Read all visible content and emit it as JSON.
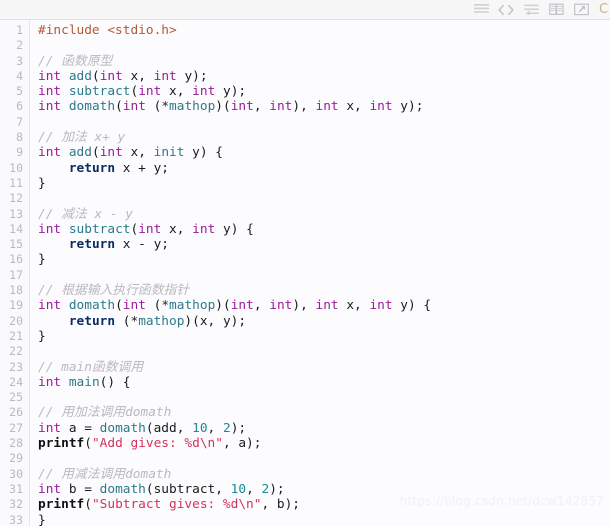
{
  "toolbar": {
    "icons": [
      {
        "name": "menu-lines-icon",
        "label": "Menu"
      },
      {
        "name": "code-brackets-icon",
        "label": "Code view"
      },
      {
        "name": "wrap-lines-icon",
        "label": "Toggle word wrap"
      },
      {
        "name": "copy-icon",
        "label": "Copy"
      },
      {
        "name": "open-external-icon",
        "label": "Open in new window"
      }
    ],
    "language_label": "C"
  },
  "editor": {
    "line_numbers": [
      "1",
      "2",
      "3",
      "4",
      "5",
      "6",
      "7",
      "8",
      "9",
      "10",
      "11",
      "12",
      "13",
      "14",
      "15",
      "16",
      "17",
      "18",
      "19",
      "20",
      "21",
      "22",
      "23",
      "24",
      "25",
      "26",
      "27",
      "28",
      "29",
      "30",
      "31",
      "32",
      "33"
    ],
    "lines": [
      [
        {
          "t": "pre",
          "s": "#include <stdio.h>"
        }
      ],
      [],
      [
        {
          "t": "cmt",
          "s": "// 函数原型"
        }
      ],
      [
        {
          "t": "kw",
          "s": "int"
        },
        {
          "t": "plain",
          "s": " "
        },
        {
          "t": "fn",
          "s": "add"
        },
        {
          "t": "plain",
          "s": "("
        },
        {
          "t": "kw",
          "s": "int"
        },
        {
          "t": "plain",
          "s": " x, "
        },
        {
          "t": "kw",
          "s": "int"
        },
        {
          "t": "plain",
          "s": " y);"
        }
      ],
      [
        {
          "t": "kw",
          "s": "int"
        },
        {
          "t": "plain",
          "s": " "
        },
        {
          "t": "fn",
          "s": "subtract"
        },
        {
          "t": "plain",
          "s": "("
        },
        {
          "t": "kw",
          "s": "int"
        },
        {
          "t": "plain",
          "s": " x, "
        },
        {
          "t": "kw",
          "s": "int"
        },
        {
          "t": "plain",
          "s": " y);"
        }
      ],
      [
        {
          "t": "kw",
          "s": "int"
        },
        {
          "t": "plain",
          "s": " "
        },
        {
          "t": "fn",
          "s": "domath"
        },
        {
          "t": "plain",
          "s": "("
        },
        {
          "t": "kw",
          "s": "int"
        },
        {
          "t": "plain",
          "s": " (*"
        },
        {
          "t": "fn",
          "s": "mathop"
        },
        {
          "t": "plain",
          "s": ")("
        },
        {
          "t": "kw",
          "s": "int"
        },
        {
          "t": "plain",
          "s": ", "
        },
        {
          "t": "kw",
          "s": "int"
        },
        {
          "t": "plain",
          "s": "), "
        },
        {
          "t": "kw",
          "s": "int"
        },
        {
          "t": "plain",
          "s": " x, "
        },
        {
          "t": "kw",
          "s": "int"
        },
        {
          "t": "plain",
          "s": " y);"
        }
      ],
      [],
      [
        {
          "t": "cmt",
          "s": "// 加法 x+ y"
        }
      ],
      [
        {
          "t": "kw",
          "s": "int"
        },
        {
          "t": "plain",
          "s": " "
        },
        {
          "t": "fn",
          "s": "add"
        },
        {
          "t": "plain",
          "s": "("
        },
        {
          "t": "kw",
          "s": "int"
        },
        {
          "t": "plain",
          "s": " x, "
        },
        {
          "t": "fn",
          "s": "init"
        },
        {
          "t": "plain",
          "s": " y) {"
        }
      ],
      [
        {
          "t": "plain",
          "s": "    "
        },
        {
          "t": "kw2",
          "s": "return"
        },
        {
          "t": "plain",
          "s": " x + y;"
        }
      ],
      [
        {
          "t": "plain",
          "s": "}"
        }
      ],
      [],
      [
        {
          "t": "cmt",
          "s": "// 减法 x - y"
        }
      ],
      [
        {
          "t": "kw",
          "s": "int"
        },
        {
          "t": "plain",
          "s": " "
        },
        {
          "t": "fn",
          "s": "subtract"
        },
        {
          "t": "plain",
          "s": "("
        },
        {
          "t": "kw",
          "s": "int"
        },
        {
          "t": "plain",
          "s": " x, "
        },
        {
          "t": "kw",
          "s": "int"
        },
        {
          "t": "plain",
          "s": " y) {"
        }
      ],
      [
        {
          "t": "plain",
          "s": "    "
        },
        {
          "t": "kw2",
          "s": "return"
        },
        {
          "t": "plain",
          "s": " x - y;"
        }
      ],
      [
        {
          "t": "plain",
          "s": "}"
        }
      ],
      [],
      [
        {
          "t": "cmt",
          "s": "// 根据输入执行函数指针"
        }
      ],
      [
        {
          "t": "kw",
          "s": "int"
        },
        {
          "t": "plain",
          "s": " "
        },
        {
          "t": "fn",
          "s": "domath"
        },
        {
          "t": "plain",
          "s": "("
        },
        {
          "t": "kw",
          "s": "int"
        },
        {
          "t": "plain",
          "s": " (*"
        },
        {
          "t": "fn",
          "s": "mathop"
        },
        {
          "t": "plain",
          "s": ")("
        },
        {
          "t": "kw",
          "s": "int"
        },
        {
          "t": "plain",
          "s": ", "
        },
        {
          "t": "kw",
          "s": "int"
        },
        {
          "t": "plain",
          "s": "), "
        },
        {
          "t": "kw",
          "s": "int"
        },
        {
          "t": "plain",
          "s": " x, "
        },
        {
          "t": "kw",
          "s": "int"
        },
        {
          "t": "plain",
          "s": " y) {"
        }
      ],
      [
        {
          "t": "plain",
          "s": "    "
        },
        {
          "t": "kw2",
          "s": "return"
        },
        {
          "t": "plain",
          "s": " (*"
        },
        {
          "t": "fn",
          "s": "mathop"
        },
        {
          "t": "plain",
          "s": ")(x, y);"
        }
      ],
      [
        {
          "t": "plain",
          "s": "}"
        }
      ],
      [],
      [
        {
          "t": "cmt",
          "s": "// main函数调用"
        }
      ],
      [
        {
          "t": "kw",
          "s": "int"
        },
        {
          "t": "plain",
          "s": " "
        },
        {
          "t": "fn",
          "s": "main"
        },
        {
          "t": "plain",
          "s": "() {"
        }
      ],
      [],
      [
        {
          "t": "cmt",
          "s": "// 用加法调用domath"
        }
      ],
      [
        {
          "t": "kw",
          "s": "int"
        },
        {
          "t": "plain",
          "s": " a = "
        },
        {
          "t": "fn",
          "s": "domath"
        },
        {
          "t": "plain",
          "s": "(add, "
        },
        {
          "t": "num",
          "s": "10"
        },
        {
          "t": "plain",
          "s": ", "
        },
        {
          "t": "num",
          "s": "2"
        },
        {
          "t": "plain",
          "s": ");"
        }
      ],
      [
        {
          "t": "bold",
          "s": "printf"
        },
        {
          "t": "plain",
          "s": "("
        },
        {
          "t": "str",
          "s": "\"Add gives: %d\\n\""
        },
        {
          "t": "plain",
          "s": ", a);"
        }
      ],
      [],
      [
        {
          "t": "cmt",
          "s": "// 用减法调用domath"
        }
      ],
      [
        {
          "t": "kw",
          "s": "int"
        },
        {
          "t": "plain",
          "s": " b = "
        },
        {
          "t": "fn",
          "s": "domath"
        },
        {
          "t": "plain",
          "s": "(subtract, "
        },
        {
          "t": "num",
          "s": "10"
        },
        {
          "t": "plain",
          "s": ", "
        },
        {
          "t": "num",
          "s": "2"
        },
        {
          "t": "plain",
          "s": ");"
        }
      ],
      [
        {
          "t": "bold",
          "s": "printf"
        },
        {
          "t": "plain",
          "s": "("
        },
        {
          "t": "str",
          "s": "\"Subtract gives: %d\\n\""
        },
        {
          "t": "plain",
          "s": ", b);"
        }
      ],
      [
        {
          "t": "plain",
          "s": "}"
        }
      ]
    ]
  },
  "watermark": {
    "text": "https://blog.csdn.net/dcw142857"
  },
  "colors": {
    "background": "#fcfcfe",
    "gutter_background": "#fafafc",
    "toolbar_background": "#f7f7f7",
    "line_number": "#b9b9bf",
    "preprocessor": "#b25a34",
    "comment": "#b9b9bf",
    "keyword_type": "#9b1b9b",
    "keyword_return": "#0b2a66",
    "function": "#2b7a8c",
    "number": "#1b8a93",
    "string": "#d3335b",
    "plain_text": "#1b1b1b"
  }
}
